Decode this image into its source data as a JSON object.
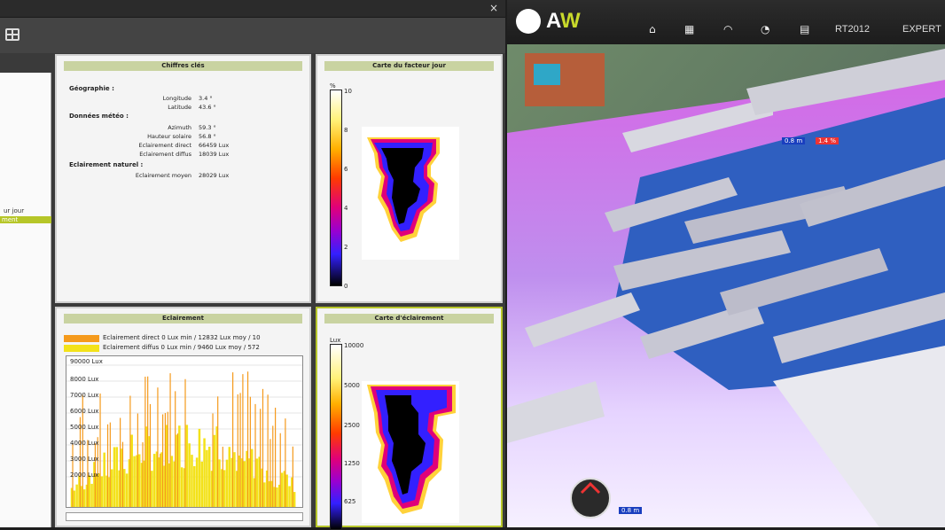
{
  "window": {
    "close_glyph": "×"
  },
  "tree": {
    "items": [
      {
        "label": "ur jour",
        "selected": false
      },
      {
        "label": "ment",
        "selected": true
      }
    ]
  },
  "key_figures": {
    "title": "Chiffres clés",
    "geo_heading": "Géographie :",
    "longitude_label": "Longitude",
    "longitude_value": "3.4 °",
    "latitude_label": "Latitude",
    "latitude_value": "43.6 °",
    "weather_heading": "Données météo :",
    "azimuth_label": "Azimuth",
    "azimuth_value": "59.3 °",
    "sun_height_label": "Hauteur solaire",
    "sun_height_value": "56.8 °",
    "direct_label": "Eclairement direct",
    "direct_value": "66459 Lux",
    "diffuse_label": "Eclairement diffus",
    "diffuse_value": "18039 Lux",
    "natural_heading": "Eclairement naturel :",
    "avg_label": "Eclairement moyen",
    "avg_value": "28029 Lux"
  },
  "daylight_map": {
    "title": "Carte du facteur jour",
    "unit": "%",
    "scale": [
      "10",
      "8",
      "6",
      "4",
      "2",
      "0"
    ]
  },
  "illumination": {
    "title": "Eclairement",
    "legend_direct": "Eclairement direct 0 Lux min / 12832 Lux moy / 10",
    "legend_diffuse": "Eclairement diffus 0 Lux min / 9460 Lux moy / 572",
    "y_labels": [
      "90000 Lux",
      "8000 Lux",
      "7000 Lux",
      "6000 Lux",
      "5000 Lux",
      "4000 Lux",
      "3000 Lux",
      "2000 Lux"
    ],
    "colors": {
      "direct": "#f59a1c",
      "diffuse": "#f3e21a"
    }
  },
  "illum_map": {
    "title": "Carte d'éclairement",
    "unit": "Lux",
    "scale": [
      "10000",
      "5000",
      "2500",
      "1250",
      "625"
    ]
  },
  "topbar": {
    "brand_a": "A",
    "brand_w": "W",
    "nav": [
      {
        "icon": "home-icon",
        "glyph": "⌂"
      },
      {
        "icon": "plan-icon",
        "glyph": "▦"
      },
      {
        "icon": "wifi-icon",
        "glyph": "◠"
      },
      {
        "icon": "chart-icon",
        "glyph": "◔"
      },
      {
        "icon": "document-icon",
        "glyph": "▤"
      }
    ],
    "rt_label": "RT2012",
    "expert_label": "EXPERT"
  },
  "scene": {
    "measure_top_a": "0.8 m",
    "measure_top_b": "1.4 %",
    "measure_bottom": "0.8 m"
  }
}
